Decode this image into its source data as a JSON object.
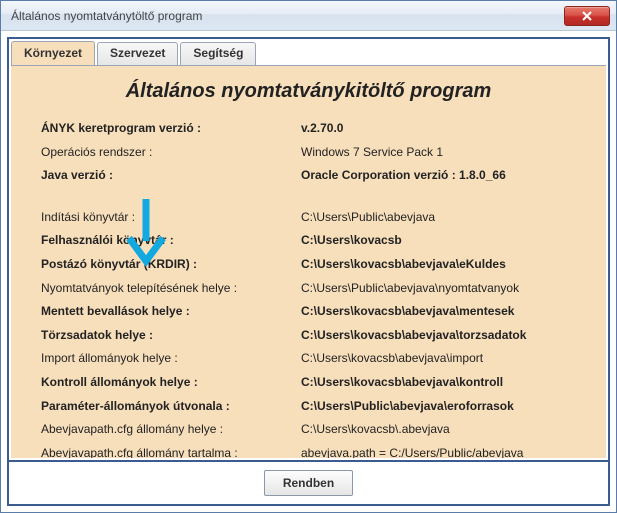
{
  "window": {
    "title": "Általános nyomtatványtöltő program"
  },
  "tabs": {
    "env": "Környezet",
    "org": "Szervezet",
    "help": "Segítség"
  },
  "panel": {
    "title": "Általános nyomtatványkitöltő program"
  },
  "rows": {
    "r0": {
      "label": "ÁNYK keretprogram verzió :",
      "value": "v.2.70.0",
      "bold": true
    },
    "r1": {
      "label": "Operációs rendszer :",
      "value": "Windows 7 Service Pack 1"
    },
    "r2": {
      "label": "Java verzió :",
      "value": "Oracle Corporation verzió : 1.8.0_66",
      "bold": true
    },
    "r3": {
      "label": "Indítási könyvtár :",
      "value": "C:\\Users\\Public\\abevjava"
    },
    "r4": {
      "label": "Felhasználói könyvtár :",
      "value": "C:\\Users\\kovacsb",
      "bold": true
    },
    "r5": {
      "label": "Postázó könyvtár (KRDIR) :",
      "value": "C:\\Users\\kovacsb\\abevjava\\eKuldes",
      "bold": true
    },
    "r6": {
      "label": "Nyomtatványok telepítésének helye :",
      "value": "C:\\Users\\Public\\abevjava\\nyomtatvanyok"
    },
    "r7": {
      "label": "Mentett bevallások helye :",
      "value": "C:\\Users\\kovacsb\\abevjava\\mentesek",
      "bold": true
    },
    "r8": {
      "label": "Törzsadatok helye :",
      "value": "C:\\Users\\kovacsb\\abevjava\\torzsadatok",
      "bold": true
    },
    "r9": {
      "label": "Import állományok helye :",
      "value": "C:\\Users\\kovacsb\\abevjava\\import"
    },
    "r10": {
      "label": "Kontroll állományok helye :",
      "value": "C:\\Users\\kovacsb\\abevjava\\kontroll",
      "bold": true
    },
    "r11": {
      "label": "Paraméter-állományok útvonala :",
      "value": "C:\\Users\\Public\\abevjava\\eroforrasok",
      "bold": true
    },
    "r12": {
      "label": "Abevjavapath.cfg állomány helye :",
      "value": "C:\\Users\\kovacsb\\.abevjava"
    },
    "r13": {
      "label": "Abevjavapath.cfg állomány tartalma :",
      "value": "abevjava.path = C:/Users/Public/abevjava"
    }
  },
  "footer": {
    "ok": "Rendben"
  }
}
